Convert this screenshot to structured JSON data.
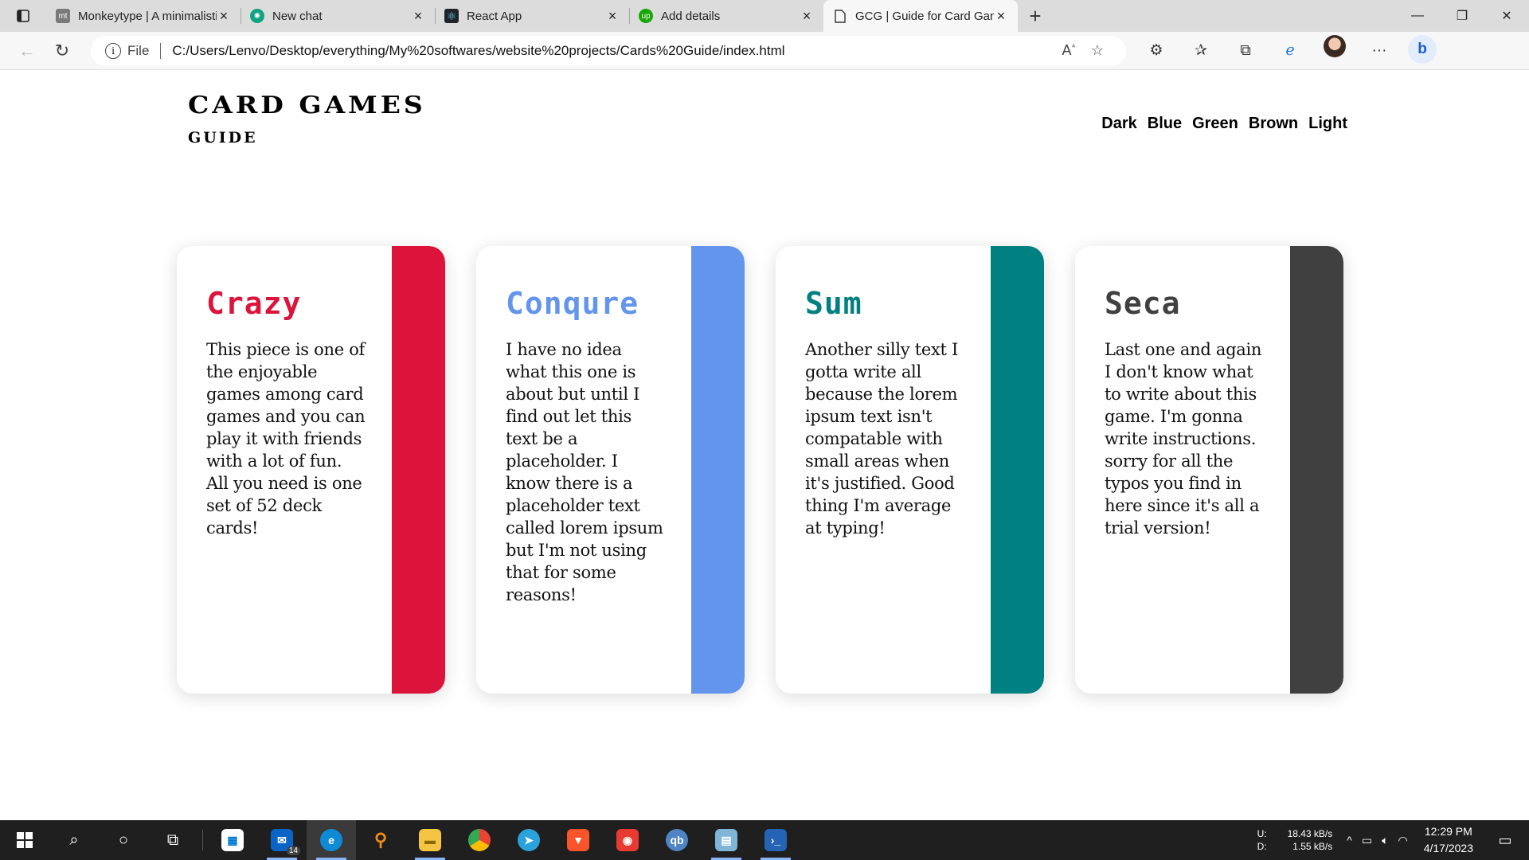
{
  "browser": {
    "tabs": [
      {
        "label": "Monkeytype | A minimalistic, cus",
        "icon": "monkeytype-icon",
        "active": false
      },
      {
        "label": "New chat",
        "icon": "chatgpt-icon",
        "active": false
      },
      {
        "label": "React App",
        "icon": "react-icon",
        "active": false
      },
      {
        "label": "Add details",
        "icon": "upwork-icon",
        "active": false
      },
      {
        "label": "GCG | Guide for Card Games",
        "icon": "file-icon",
        "active": true
      }
    ],
    "address": {
      "scheme_label": "File",
      "url": "C:/Users/Lenvo/Desktop/everything/My%20softwares/website%20projects/Cards%20Guide/index.html"
    }
  },
  "site": {
    "logo_title": "Card Games",
    "logo_subtitle": "Guide",
    "themes": [
      "Dark",
      "Blue",
      "Green",
      "Brown",
      "Light"
    ]
  },
  "cards": [
    {
      "title": "Crazy",
      "color": "#dc143c",
      "text": "This piece is one of the enjoyable games among card games and you can play it with friends with a lot of fun. All you need is one set of 52 deck cards!"
    },
    {
      "title": "Conqure",
      "color": "#6495ed",
      "text": "I have no idea what this one is about but until I find out let this text be a placeholder. I know there is a placeholder text called lorem ipsum but I'm not using that for some reasons!"
    },
    {
      "title": "Sum",
      "color": "#008080",
      "text": "Another silly text I gotta write all because the lorem ipsum text isn't compatable with small areas when it's justified. Good thing I'm average at typing!"
    },
    {
      "title": "Seca",
      "color": "#404040",
      "text": "Last one and again I don't know what to write about this game. I'm gonna write instructions. sorry for all the typos you find in here since it's all a trial version!"
    }
  ],
  "taskbar": {
    "mail_badge": "14",
    "net_upload_label": "U:",
    "net_download_label": "D:",
    "net_upload": "18.43 kB/s",
    "net_download": "1.55 kB/s",
    "time": "12:29 PM",
    "date": "4/17/2023"
  }
}
